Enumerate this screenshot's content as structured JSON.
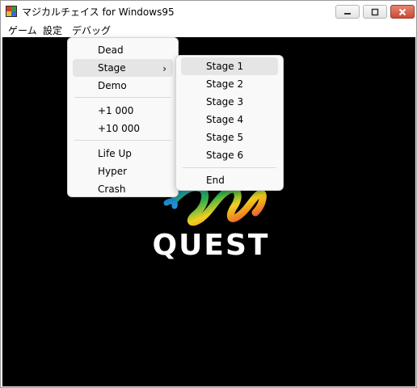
{
  "window": {
    "title": "マジカルチェイス for Windows95"
  },
  "menubar": {
    "items": [
      "ゲーム",
      "設定",
      "デバッグ"
    ]
  },
  "debug_menu": {
    "items": [
      "Dead",
      "Stage",
      "Demo",
      "+1 000",
      "+10 000",
      "Life Up",
      "Hyper",
      "Crash"
    ],
    "highlighted": "Stage"
  },
  "stage_submenu": {
    "items": [
      "Stage 1",
      "Stage 2",
      "Stage 3",
      "Stage 4",
      "Stage 5",
      "Stage 6",
      "End"
    ],
    "highlighted": "Stage 1"
  },
  "logo": {
    "text": "QUEST"
  },
  "colors": {
    "game_background": "#000000",
    "close_button": "#c94b35",
    "menu_highlight": "#e5e5e5"
  },
  "icons": {
    "app": "app-icon",
    "minimize": "minimize-icon",
    "maximize": "maximize-icon",
    "close": "close-icon",
    "submenu": "chevron-right-icon"
  }
}
